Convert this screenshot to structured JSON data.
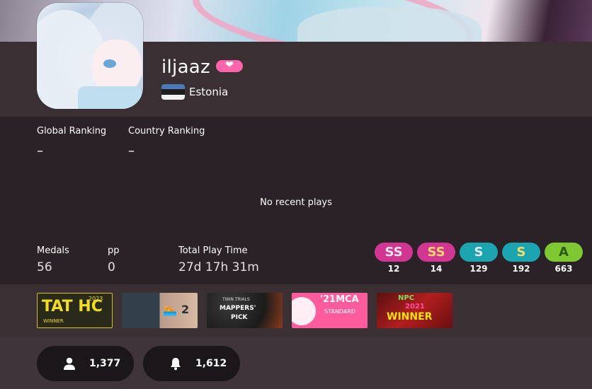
{
  "profile": {
    "username": "iljaaz",
    "supporter_icon": "heart-icon",
    "country": "Estonia"
  },
  "rankings": {
    "global_label": "Global Ranking",
    "global_value": "–",
    "country_label": "Country Ranking",
    "country_value": "–"
  },
  "recent": {
    "empty_text": "No recent plays"
  },
  "stats": {
    "medals_label": "Medals",
    "medals": "56",
    "pp_label": "pp",
    "pp": "0",
    "playtime_label": "Total Play Time",
    "playtime": "27d 17h 31m"
  },
  "grades": [
    {
      "label": "SS",
      "count": "12",
      "bg": "#d13692",
      "fg": "#e8e8e8"
    },
    {
      "label": "SS",
      "count": "14",
      "bg": "#d13692",
      "fg": "#ffd966"
    },
    {
      "label": "S",
      "count": "129",
      "bg": "#1aa5b0",
      "fg": "#e8e8e8"
    },
    {
      "label": "S",
      "count": "192",
      "bg": "#1aa5b0",
      "fg": "#ffd966"
    },
    {
      "label": "A",
      "count": "663",
      "bg": "#7ec932",
      "fg": "#2d5a10"
    }
  ],
  "badges": [
    {
      "title": "TAT HC",
      "sub": "2023",
      "note": "WINNER"
    },
    {
      "title": "2",
      "sub": "",
      "note": ""
    },
    {
      "title": "TWIN TRIALS",
      "sub": "MAPPERS'",
      "note": "PICK"
    },
    {
      "title": "'21MCA",
      "sub": "STANDARD",
      "note": ""
    },
    {
      "title": "NPC",
      "sub": "2021",
      "note": "WINNER"
    }
  ],
  "footer": {
    "followers": "1,377",
    "followers_icon": "user-icon",
    "subscribers": "1,612",
    "subscribers_icon": "bell-icon"
  }
}
